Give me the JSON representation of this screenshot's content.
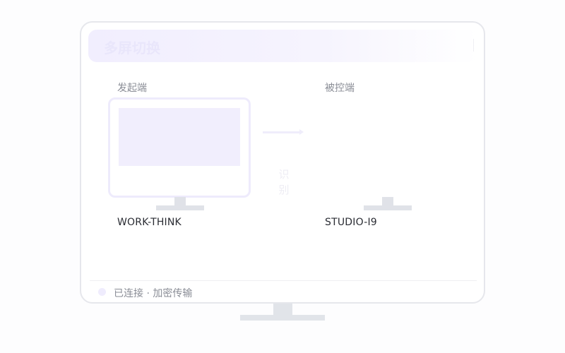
{
  "header": {
    "title": "多屏切换"
  },
  "initiator": {
    "label": "发起端",
    "device_name": "WORK-THINK"
  },
  "controlled": {
    "label": "被控端",
    "device_name": "STUDIO-I9"
  },
  "center": {
    "text": "识别"
  },
  "status": {
    "text": "已连接 · 加密传输"
  },
  "colors": {
    "accent": "#f1eefd",
    "frame": "#e6e7ec",
    "stand": "#e0e2e8"
  }
}
